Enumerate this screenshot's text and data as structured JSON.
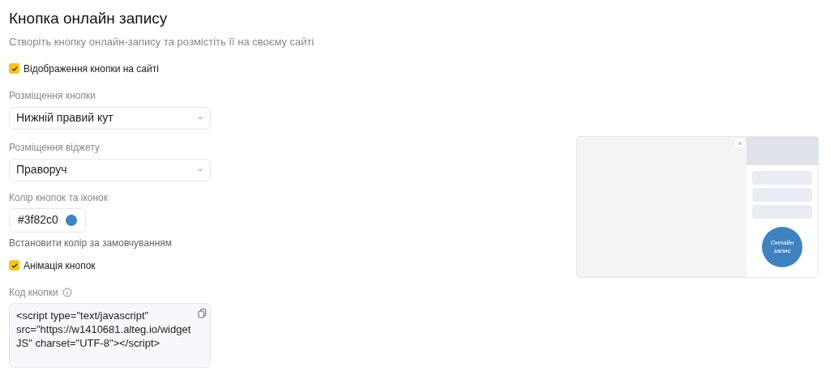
{
  "title": "Кнопка онлайн запису",
  "subtitle": "Створіть кнопку онлайн-запису та розмістіть її на своєму сайті",
  "show_on_site": {
    "label": "Відображення кнопки на сайті",
    "checked": true
  },
  "button_position": {
    "label": "Розміщення кнопки",
    "value": "Нижній правий кут"
  },
  "widget_position": {
    "label": "Розміщення віджету",
    "value": "Праворуч"
  },
  "button_color": {
    "label": "Колір кнопок та іконок",
    "value": "#3f82c0",
    "color": "#3f82c0",
    "reset_link": "Встановити колір за замовчуванням"
  },
  "animation": {
    "label": "Анімація кнопок",
    "checked": true
  },
  "code": {
    "label": "Код кнопки",
    "value": "<script type=\"text/javascript\" src=\"https://w1410681.alteg.io/widgetJS\" charset=\"UTF-8\"></script>"
  },
  "preview": {
    "close": "×",
    "button_label": "Онлайн запис"
  }
}
